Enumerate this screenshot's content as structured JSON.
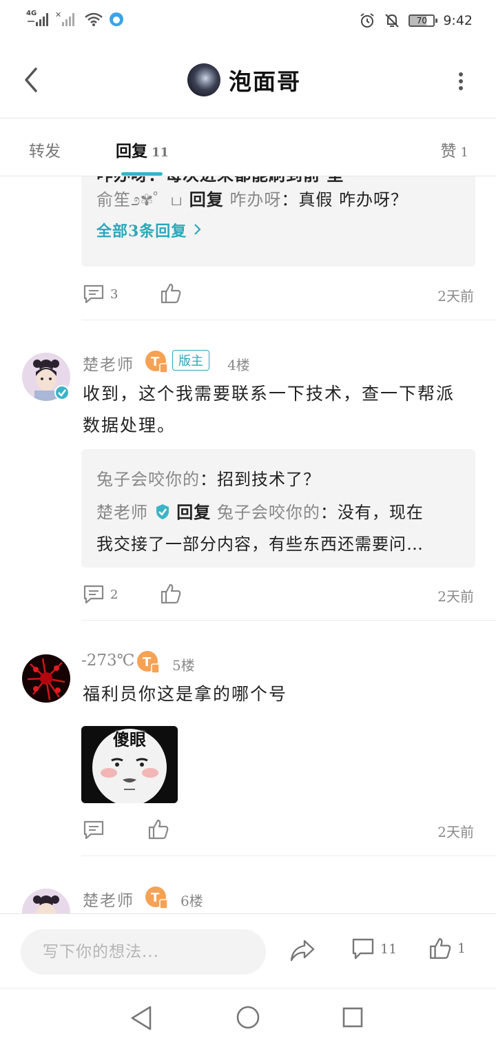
{
  "status_bar": {
    "network_1": "4G",
    "battery": "70",
    "time": "9:42"
  },
  "header": {
    "title": "泡面哥"
  },
  "tabs": [
    {
      "label": "转发",
      "count": ""
    },
    {
      "label": "回复",
      "count": "11"
    },
    {
      "label": "赞",
      "count": "1"
    }
  ],
  "posts": {
    "prev": {
      "top_line": "咋办呀：每次进来都能刷到前 室",
      "reply_name": "俞笙೨✾゜ப",
      "reply_word": "回复",
      "reply_target": "咋办呀",
      "reply_text": "：真假  咋办呀？",
      "more_replies": "全部3条回复",
      "comment_count": "3",
      "time": "2天前"
    },
    "floor4": {
      "username": "楚老师",
      "badge": "版主",
      "floor": "4楼",
      "body_line1": "收到，这个我需要联系一下技术，查一下帮派",
      "body_line2": "数据处理。",
      "sub1_name": "兔子会咬你的",
      "sub1_text": "：招到技术了？",
      "sub2_name": "楚老师",
      "sub2_reply": "回复",
      "sub2_target": "兔子会咬你的",
      "sub2_text": "：没有，现在",
      "sub2_line2": "我交接了一部分内容，有些东西还需要问…",
      "comment_count": "2",
      "time": "2天前"
    },
    "floor5": {
      "username": "-273℃",
      "floor": "5楼",
      "body": "福利员你这是拿的哪个号",
      "sticker_text": "傻眼",
      "time": "2天前"
    },
    "floor6": {
      "username": "楚老师",
      "floor": "6楼"
    }
  },
  "bottom_bar": {
    "input_placeholder": "写下你的想法...",
    "comment_count": "11",
    "like_count": "1"
  }
}
